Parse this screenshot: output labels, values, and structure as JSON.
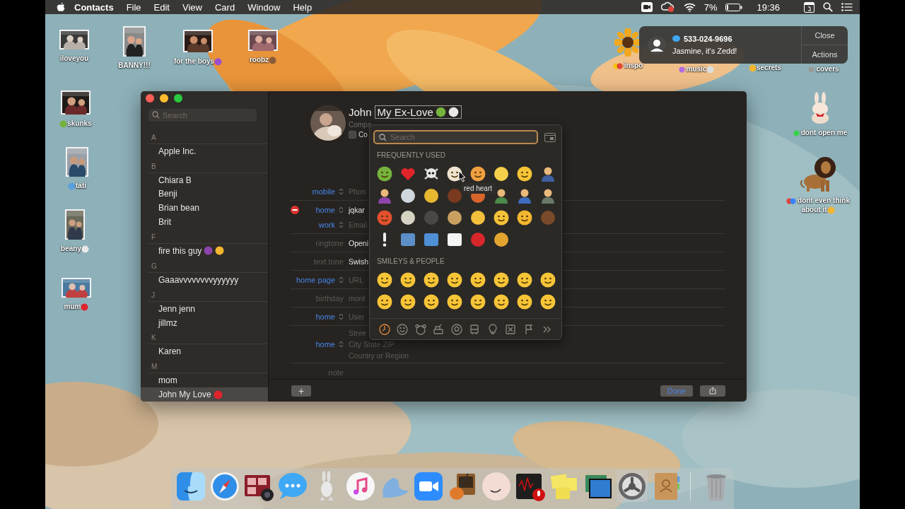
{
  "menu_bar": {
    "app_name": "Contacts",
    "menus": [
      "File",
      "Edit",
      "View",
      "Card",
      "Window",
      "Help"
    ],
    "battery": "7%",
    "time": "19:36"
  },
  "desktop_items": [
    {
      "label": "iloveyou",
      "kind": "thumbnail"
    },
    {
      "label": "BANNY!!!",
      "kind": "thumbnail"
    },
    {
      "label": "for the boys",
      "kind": "thumbnail",
      "after": [
        {
          "color": "#9b4fd0"
        }
      ]
    },
    {
      "label": "roobz",
      "kind": "thumbnail",
      "after": [
        {
          "color": "#8a5a3a"
        }
      ]
    },
    {
      "label": "inspo",
      "kind": "thumbnail",
      "tags": [
        {
          "color": "#f5c400"
        },
        {
          "color": "#e0443a"
        }
      ]
    },
    {
      "label": "music",
      "kind": "label",
      "tags": [
        {
          "color": "#b36ae2"
        }
      ],
      "after": [
        {
          "color": "#dddddd"
        }
      ]
    },
    {
      "label": "secrets",
      "kind": "label",
      "before": [
        {
          "color": "#f2b631"
        }
      ]
    },
    {
      "label": "covers",
      "kind": "label",
      "tags": [
        {
          "color": "#9a9a9a"
        }
      ]
    },
    {
      "label": "skunks",
      "kind": "thumbnail",
      "before": [
        {
          "color": "#74b33c"
        }
      ]
    },
    {
      "label": "tati",
      "kind": "thumbnail",
      "before": [
        {
          "color": "#5aa0e0"
        }
      ]
    },
    {
      "label": "beany",
      "kind": "thumbnail",
      "after": [
        {
          "color": "#e8e8e8"
        }
      ]
    },
    {
      "label": "mum",
      "kind": "thumbnail",
      "after": [
        {
          "color": "#e0242b"
        }
      ]
    },
    {
      "label": "dont open me",
      "kind": "thumbnail",
      "tags": [
        {
          "color": "#3ccf4e"
        }
      ]
    },
    {
      "label": "dont even think about it",
      "kind": "thumbnail",
      "tags": [
        {
          "color": "#e0443a"
        },
        {
          "color": "#3b82f6"
        }
      ],
      "after": [
        {
          "color": "#f2b631"
        }
      ]
    }
  ],
  "notification": {
    "phone": "533-024-9696",
    "message": "Jasmine, it's Zedd!",
    "buttons": [
      "Close",
      "Actions"
    ]
  },
  "contacts_window": {
    "search_placeholder": "Search",
    "groups": [
      {
        "letter": "A",
        "contacts": [
          {
            "name": "Apple Inc.",
            "selected": false
          }
        ]
      },
      {
        "letter": "B",
        "contacts": [
          {
            "name": "Chiara B",
            "selected": false
          },
          {
            "name": "Benji",
            "selected": false
          },
          {
            "name": "Brian bean",
            "selected": false
          },
          {
            "name": "Brit",
            "selected": false
          }
        ]
      },
      {
        "letter": "F",
        "contacts": [
          {
            "name": "fire this guy",
            "selected": false,
            "emojis": [
              {
                "color": "#8e44ad"
              },
              {
                "color": "#f2b631"
              }
            ]
          }
        ]
      },
      {
        "letter": "G",
        "contacts": [
          {
            "name": "Gaaavvvvvvvvyyyyyy",
            "selected": false
          }
        ]
      },
      {
        "letter": "J",
        "contacts": [
          {
            "name": "Jenn jenn",
            "selected": false
          },
          {
            "name": "jillmz",
            "selected": false
          }
        ]
      },
      {
        "letter": "K",
        "contacts": [
          {
            "name": "Karen",
            "selected": false
          }
        ]
      },
      {
        "letter": "M",
        "contacts": [
          {
            "name": "mom",
            "selected": false
          },
          {
            "name": "John My Love",
            "selected": true,
            "emojis": [
              {
                "color": "#e0242b"
              }
            ]
          }
        ]
      }
    ],
    "card": {
      "first_name": "John",
      "nickname": "My Ex-Love",
      "nickname_emojis": [
        {
          "color": "#74b33c"
        },
        {
          "color": "#e8e8e8"
        }
      ],
      "company_placeholder": "Compa",
      "company_checkbox": {
        "label": "Co",
        "checked": false
      },
      "field_groups": [
        {
          "rows": [
            {
              "label": "mobile",
              "kind": "popup",
              "values": [
                "Phon"
              ],
              "filled": false,
              "removable": false
            }
          ]
        },
        {
          "rows": [
            {
              "label": "home",
              "kind": "popup",
              "values": [
                "jqkar"
              ],
              "filled": true,
              "removable": true
            },
            {
              "label": "work",
              "kind": "popup",
              "values": [
                "Email"
              ],
              "filled": false,
              "removable": false
            }
          ]
        },
        {
          "rows": [
            {
              "label": "ringtone",
              "kind": "static",
              "values": [
                "Openi"
              ],
              "filled": true,
              "removable": false
            }
          ]
        },
        {
          "rows": [
            {
              "label": "text tone",
              "kind": "static",
              "values": [
                "Swish"
              ],
              "filled": true,
              "removable": false
            }
          ]
        },
        {
          "rows": [
            {
              "label": "home page",
              "kind": "popup",
              "values": [
                "URL"
              ],
              "filled": false,
              "removable": false
            }
          ]
        },
        {
          "rows": [
            {
              "label": "birthday",
              "kind": "static",
              "values": [
                "mont"
              ],
              "filled": false,
              "removable": false
            }
          ]
        },
        {
          "rows": [
            {
              "label": "home",
              "kind": "popup",
              "values": [
                "User"
              ],
              "filled": false,
              "removable": false
            }
          ]
        },
        {
          "rows": [
            {
              "label": "home",
              "kind": "popup",
              "values": [
                "Stree",
                "City State ZIP",
                "Country or Region"
              ],
              "filled": false,
              "removable": false
            }
          ]
        },
        {
          "rows": [
            {
              "label": "note",
              "kind": "static",
              "removable": false
            }
          ]
        }
      ],
      "add_button": "+",
      "done_button": "Done"
    }
  },
  "emoji_picker": {
    "search_placeholder": "Search",
    "tooltip": "red heart",
    "sections": [
      {
        "title": "FREQUENTLY USED",
        "emojis": [
          {
            "kind": "face",
            "color": "#74b33c"
          },
          {
            "kind": "heart",
            "color": "#e0242b"
          },
          {
            "kind": "skull",
            "color": "#e8e8e8"
          },
          {
            "kind": "face",
            "color": "#efe3cf"
          },
          {
            "kind": "face",
            "color": "#f0a040"
          },
          {
            "kind": "round",
            "color": "#f5d04a"
          },
          {
            "kind": "face",
            "color": "#f6c437"
          },
          {
            "kind": "person",
            "color": "#3f5f9f"
          },
          {
            "kind": "person",
            "color": "#8e44ad"
          },
          {
            "kind": "round",
            "color": "#cfd6dc"
          },
          {
            "kind": "round",
            "color": "#e8b830"
          },
          {
            "kind": "round",
            "color": "#7a3a20"
          },
          {
            "kind": "round",
            "color": "#d9652b"
          },
          {
            "kind": "person",
            "color": "#4a8a4a"
          },
          {
            "kind": "person",
            "color": "#3d6cc0"
          },
          {
            "kind": "person",
            "color": "#6a7a6a"
          },
          {
            "kind": "face",
            "color": "#e2512e"
          },
          {
            "kind": "round",
            "color": "#d8d4c4"
          },
          {
            "kind": "round",
            "color": "#4a4845"
          },
          {
            "kind": "round",
            "color": "#c9a060"
          },
          {
            "kind": "round",
            "color": "#f2c03a"
          },
          {
            "kind": "face",
            "color": "#f4c23a"
          },
          {
            "kind": "face",
            "color": "#f2b631"
          },
          {
            "kind": "round",
            "color": "#7a4b2a"
          },
          {
            "kind": "exclaim",
            "color": "#f0f0f0"
          },
          {
            "kind": "tile",
            "color": "#5d8fc9"
          },
          {
            "kind": "tile",
            "color": "#4f8fd6"
          },
          {
            "kind": "tile",
            "color": "#f5f5f5"
          },
          {
            "kind": "round",
            "color": "#d8262b"
          },
          {
            "kind": "round",
            "color": "#e4a530"
          }
        ]
      },
      {
        "title": "SMILEYS & PEOPLE",
        "emojis": [
          {
            "kind": "face",
            "color": "#f6c437"
          },
          {
            "kind": "face",
            "color": "#f6c437"
          },
          {
            "kind": "face",
            "color": "#f6c437"
          },
          {
            "kind": "face",
            "color": "#f6c437"
          },
          {
            "kind": "face",
            "color": "#f6c437"
          },
          {
            "kind": "face",
            "color": "#f6c437"
          },
          {
            "kind": "face",
            "color": "#f6c437"
          },
          {
            "kind": "face",
            "color": "#f6c437"
          },
          {
            "kind": "face",
            "color": "#f6c437"
          },
          {
            "kind": "face",
            "color": "#f6c437"
          },
          {
            "kind": "face",
            "color": "#f6c437"
          },
          {
            "kind": "face",
            "color": "#f6c437"
          },
          {
            "kind": "face",
            "color": "#f6c437"
          },
          {
            "kind": "face",
            "color": "#f6c437"
          },
          {
            "kind": "face",
            "color": "#f6c437"
          },
          {
            "kind": "face",
            "color": "#f6c437"
          }
        ]
      }
    ],
    "categories": [
      {
        "selected": true
      },
      {
        "selected": false
      },
      {
        "selected": false
      },
      {
        "selected": false
      },
      {
        "selected": false
      },
      {
        "selected": false
      },
      {
        "selected": false
      },
      {
        "selected": false
      },
      {
        "selected": false
      },
      {
        "selected": false
      }
    ]
  }
}
